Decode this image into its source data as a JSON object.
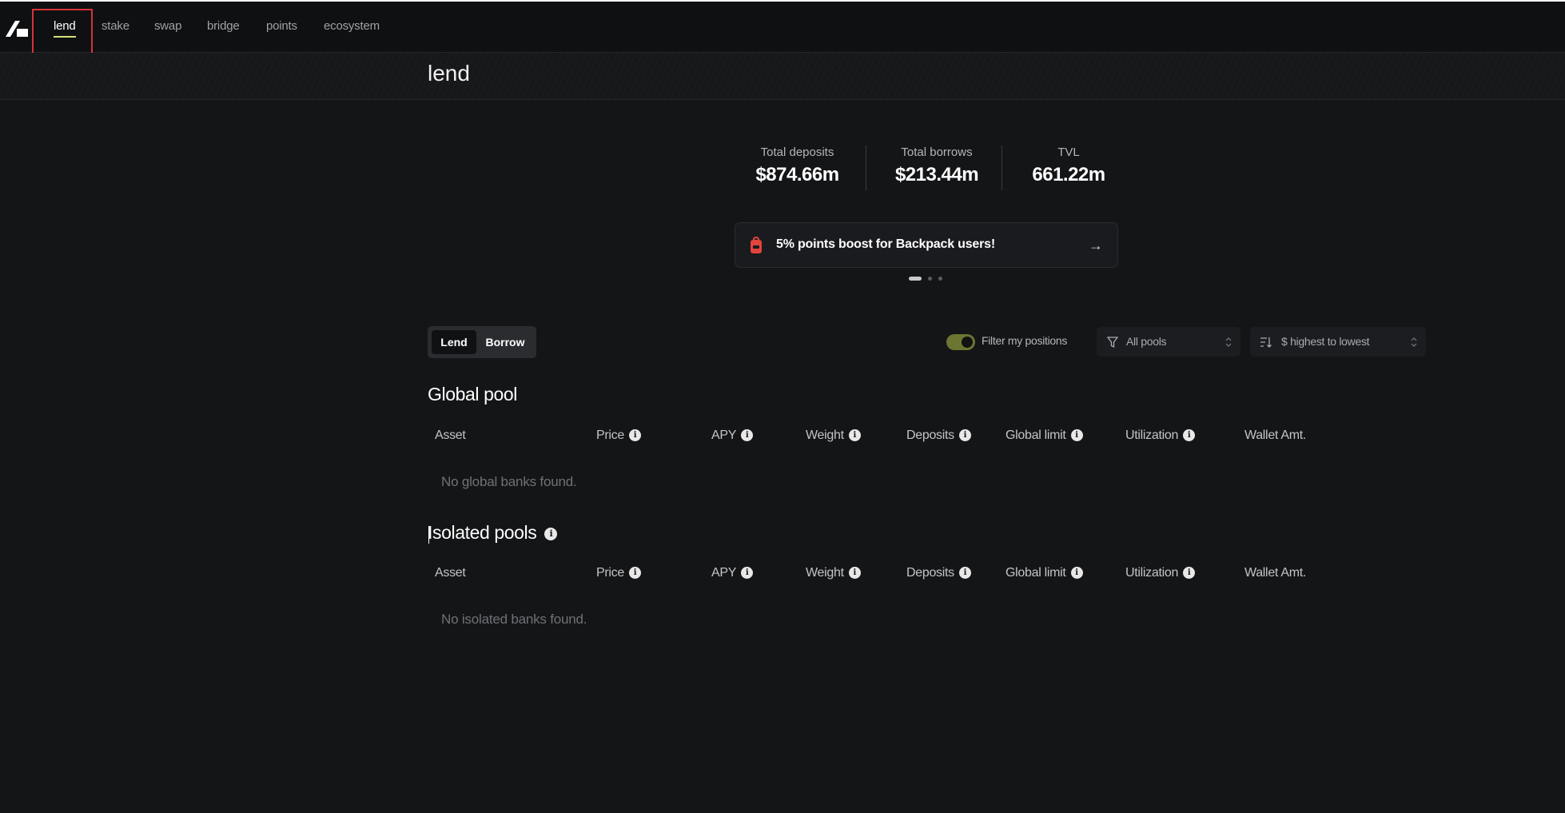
{
  "nav": {
    "items": [
      {
        "label": "lend",
        "active": true
      },
      {
        "label": "stake",
        "active": false
      },
      {
        "label": "swap",
        "active": false
      },
      {
        "label": "bridge",
        "active": false
      },
      {
        "label": "points",
        "active": false
      },
      {
        "label": "ecosystem",
        "active": false
      }
    ]
  },
  "page": {
    "title": "lend"
  },
  "stats": [
    {
      "label": "Total deposits",
      "value": "$874.66m"
    },
    {
      "label": "Total borrows",
      "value": "$213.44m"
    },
    {
      "label": "TVL",
      "value": "661.22m"
    }
  ],
  "banner": {
    "text": "5% points boost for Backpack users!",
    "icon": "backpack-icon",
    "arrow": "→"
  },
  "carousel": {
    "count": 3,
    "active": 0
  },
  "mode_toggle": {
    "lend": "Lend",
    "borrow": "Borrow",
    "active": "Lend"
  },
  "filters": {
    "my_positions_label": "Filter my positions",
    "my_positions_on": true,
    "pool_select": "All pools",
    "sort_select": "$ highest to lowest"
  },
  "columns": [
    "Asset",
    "Price",
    "APY",
    "Weight",
    "Deposits",
    "Global limit",
    "Utilization",
    "Wallet Amt."
  ],
  "global_pool": {
    "title": "Global pool",
    "empty_text": "No global banks found."
  },
  "isolated_pools": {
    "title": "Isolated pools",
    "empty_text": "No isolated banks found."
  },
  "colors": {
    "accent": "#d8e07a",
    "toggle_on": "#6c7531",
    "background": "#141517",
    "banner_icon": "#e0443b"
  }
}
